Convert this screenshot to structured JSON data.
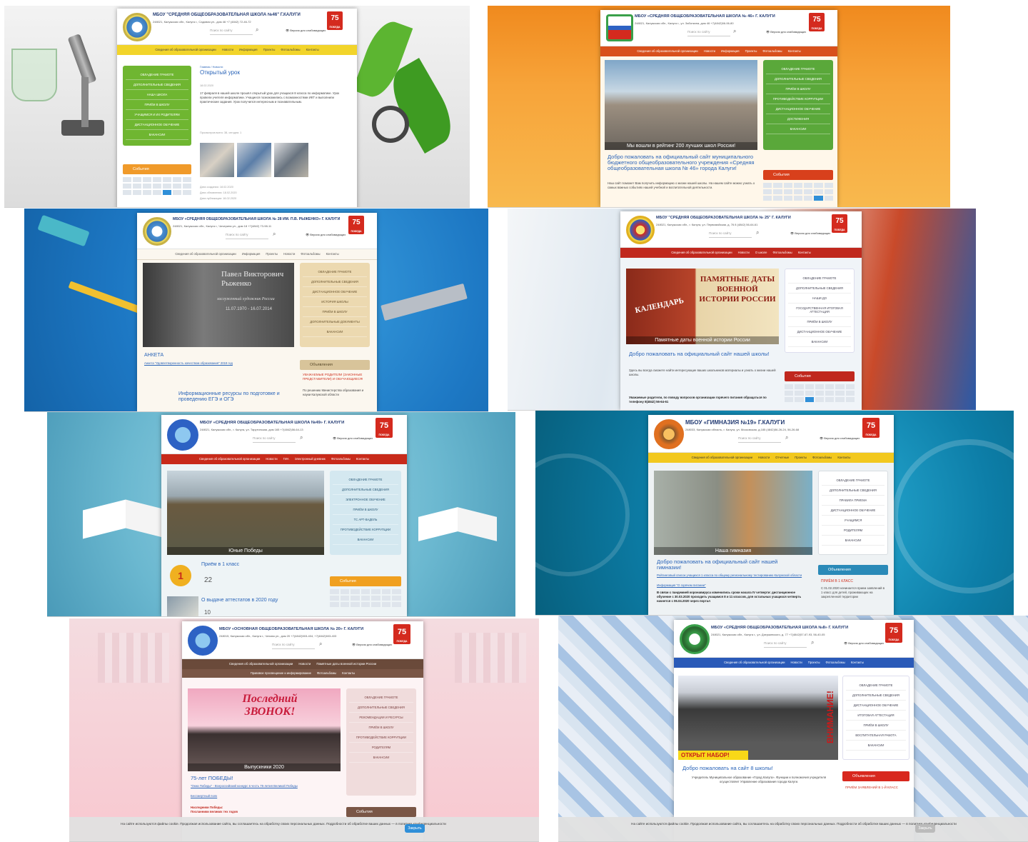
{
  "common": {
    "vision_label": "Версия для слабовидящих",
    "badge_number": "75",
    "badge_text": "ПОБЕДА"
  },
  "tile1": {
    "title": "МБОУ \"СРЕДНЯЯ ОБЩЕОБРАЗОВАТЕЛЬНАЯ ШКОЛА №46\" Г.КАЛУГИ",
    "address": "248021, Калужская обл., Калуга г., Садовая ул., дом 46   +7 (4842) 72-46-72",
    "search_placeholder": "Поиск по сайту",
    "nav": [
      "Сведения об образовательной организации",
      "Новости",
      "Информация",
      "Проекты",
      "Фотоальбомы",
      "Контакты"
    ],
    "side": [
      "Овладение грамоте",
      "Дополнительные сведения",
      "Наша школа",
      "Приём в школу",
      "Учащимся и их родителям",
      "Дистанционное обучение",
      "Вакансии"
    ],
    "breadcrumb": "Главная / Новости",
    "post_title": "Открытый урок",
    "post_date": "18.02.2020",
    "post_text": "17 февраля в нашей школе прошёл открытый урок для учащихся 8 класса по информатике. Урок провели учителя информатики. Учащиеся познакомились с возможностями ИКТ и выполнили практические задания. Урок получился интересным и познавательным.",
    "views": "Просмотров всего: 38, сегодня: 1",
    "events_label": "События",
    "dates": [
      "Дата создания: 18.02.2020",
      "Дата обновления: 18.02.2020",
      "Дата публикации: 18.02.2020"
    ]
  },
  "tile2": {
    "title": "МБОУ «СРЕДНЯЯ ОБЩЕОБРАЗОВАТЕЛЬНАЯ ШКОЛА № 46» Г. КАЛУГИ",
    "address": "248021, Калужская обл., Калуга г., ул. Заботкина, дом 46   +7(4842)56-06-80",
    "search_placeholder": "Поиск по сайту",
    "nav": [
      "Сведения об образовательной организации",
      "Новости",
      "Информация",
      "Проекты",
      "Фотоальбомы",
      "Контакты"
    ],
    "side": [
      "Овладение грамоте",
      "Дополнительные сведения",
      "Приём в школу",
      "Противодействие коррупции",
      "Дистанционное обучение",
      "Достижения",
      "Вакансии"
    ],
    "photo_caption": "Мы вошли в рейтинг 200 лучших школ России!",
    "welcome": "Добро пожаловать на официальный сайт муниципального бюджетного общеобразовательного учреждения «Средняя общеобразовательная школа № 46» города Калуги!",
    "text": "Наш сайт поможет Вам получить информацию о жизни нашей школы. На нашем сайте можно узнать о самых важных событиях нашей учебной и воспитательной деятельности.",
    "events_label": "События"
  },
  "tile3": {
    "title": "МБОУ «СРЕДНЯЯ ОБЩЕОБРАЗОВАТЕЛЬНАЯ ШКОЛА № 28 ИМ. П.В. РЫЖЕНКО» Г. КАЛУГИ",
    "address": "248021, Калужская обл., Калуга г., Чичерина ул., дом 18   +7(4842) 73-98-11",
    "search_placeholder": "Поиск по сайту",
    "nav": [
      "Сведения об образовательной организации",
      "Информация",
      "Проекты",
      "Новости",
      "Фотоальбомы",
      "Контакты"
    ],
    "side": [
      "Овладение грамоте",
      "Дополнительные сведения",
      "Дистанционное обучение",
      "История школы",
      "Приём в школу",
      "Дополнительные документы",
      "Вакансии"
    ],
    "photo_name": "Павел Викторович Рыженко",
    "photo_sub": "заслуженный художник России",
    "photo_years": "11.07.1970 - 16.07.2014",
    "anketa_title": "АНКЕТА",
    "anketa_link": "Анкета \"Удовлетворенность качеством образования\" 2019 год",
    "ads_label": "Объявления",
    "ads_title": "УВАЖАЕМЫЕ РОДИТЕЛИ (ЗАКОННЫЕ ПРЕДСТАВИТЕЛИ) И ОБУЧАЮЩИЕСЯ!",
    "ads_text": "По решению Министерства образования и науки Калужской области",
    "info_title": "Информационные ресурсы по подготовке и проведению ЕГЭ и ОГЭ"
  },
  "tile4": {
    "title": "МБОУ \"СРЕДНЯЯ ОБЩЕОБРАЗОВАТЕЛЬНАЯ ШКОЛА № 25\" Г. КАЛУГИ",
    "address": "248021, Калужская обл., г. Калуга, ул. Первомайская, д. 76   8 (4842) 56-64-61",
    "search_placeholder": "Поиск по сайту",
    "nav": [
      "Сведения об образовательной организации",
      "Новости",
      "О школе",
      "Фотоальбомы",
      "Контакты"
    ],
    "side": [
      "Овладение грамоте",
      "Дополнительные сведения",
      "Наши ДО",
      "Государственная итоговая аттестация",
      "Приём в школу",
      "Дистанционное обучение",
      "Вакансии"
    ],
    "banner_left": "КАЛЕНДАРЬ",
    "banner_right": "ПАМЯТНЫЕ ДАТЫ ВОЕННОЙ ИСТОРИИ РОССИИ",
    "photo_caption": "Памятные даты военной истории России",
    "welcome": "Добро пожаловать на официальный сайт нашей школы!",
    "text": "Здесь вы всегда сможете найти интересующие ваших школьников материалы и узнать о жизни нашей школы.",
    "bold": "Уважаемые родители, по поводу вопросов организации горячего питания обращаться по телефону 8(4842) 56-64-61",
    "events_label": "События"
  },
  "tile5": {
    "title": "МБОУ «СРЕДНЯЯ ОБЩЕОБРАЗОВАТЕЛЬНАЯ ШКОЛА №49» Г. КАЛУГИ",
    "address": "248021, Калужская обл., г. Калуга, ул. Тарутинская, дом 165   +7(4842)56-64-13",
    "search_placeholder": "Поиск по сайту",
    "nav": [
      "Сведения об образовательной организации",
      "Новости",
      "ГИА",
      "Электронный дневник",
      "Фотоальбомы",
      "Контакты"
    ],
    "side": [
      "Овладение грамоте",
      "Дополнительные сведения",
      "Электронное обучение",
      "Приём в школу",
      "ТС АРТ-ВАДЕЛЬ",
      "Противодействие коррупции",
      "Вакансии"
    ],
    "photo_caption": "Юные Победы",
    "news1": "Приём в 1 класс",
    "news1_count": "22",
    "news2": "О выдаче аттестатов в 2020 году",
    "news2_count": "10",
    "events_label": "События"
  },
  "tile6": {
    "title": "МБОУ «ГИМНАЗИЯ №19» Г.КАЛУГИ",
    "address": "248033, Калужская область, г. Калуга, ул. Московская, д.185   (4842)56-26-24, 56-26-68",
    "search_placeholder": "Поиск по сайту",
    "nav": [
      "Сведения об образовательной организации",
      "Новости",
      "Отчетные",
      "Проекты",
      "Фотоальбомы",
      "Контакты"
    ],
    "side": [
      "Овладение грамоте",
      "Дополнительные сведения",
      "Правила приема",
      "Дистанционное обучение",
      "Учащимся",
      "Родителям",
      "Вакансии"
    ],
    "photo_caption": "Наша гимназия",
    "welcome": "Добро пожаловать на официальный сайт нашей гимназии!",
    "link1": "Рейтинговый список учащихся 1 класса по общему региональному тестированию Калужской области",
    "link2": "Информация \"О горячем питании\"",
    "bold": "В связи с пандемией коронавируса изменились сроки начала IV четверти: дистанционное обучение с 30.03.2020 проходить учащимся 8 и 11 классов, для остальных учащихся четверть начнется с 06.04.2020 через портал",
    "ads_label": "Объявления",
    "ads_title": "ПРИЁМ В 1 КЛАСС",
    "ads_text": "С 01.02.2020 начинается прием заявлений в 1 класс для детей, проживающих на закрепленной территории"
  },
  "tile7": {
    "title": "МБОУ «ОСНОВНАЯ ОБЩЕОБРАЗОВАТЕЛЬНАЯ ШКОЛА № 20» Г. КАЛУГИ",
    "address": "248015, Калужская обл., Калуга г., Чехова ул., дом 20   +7(4842)503-404, +7(4842)503-403",
    "search_placeholder": "Поиск по сайту",
    "nav": [
      "Сведения об образовательной организации",
      "Новости",
      "Памятные даты военной истории России"
    ],
    "nav2": [
      "Правовое просвещение и информирование",
      "Фотоальбомы",
      "Контакты"
    ],
    "side": [
      "Овладение грамоте",
      "Дополнительные сведения",
      "Рекомендации и ресурсы",
      "Приём в школу",
      "Противодействие коррупции",
      "Родителям",
      "Вакансии"
    ],
    "banner_title": "Последний ЗВОНОК!",
    "photo_caption": "Выпускники 2020",
    "pobeda_title": "75-лет ПОБЕДЫ!",
    "pobeda_link": "\"Окна Победы\" - Всероссийский конкурс в честь 75-летия Великой Победы",
    "pobeda_link2": "Бессмертный полк",
    "heir1": "Наследники Победы:",
    "heir2": "Посланники великих тех годов",
    "events_label": "События",
    "cookie": "На сайте используются файлы cookie. Продолжая использование сайта, вы соглашаетесь на обработку своих персональных данных. Подробности об обработке ваших данных — в политике конфиденциальности",
    "cookie_btn": "Закрыть"
  },
  "tile8": {
    "title": "МБОУ «СРЕДНЯЯ ОБЩЕОБРАЗОВАТЕЛЬНАЯ ШКОЛА №8» Г. КАЛУГИ",
    "address": "248021, Калужская обл., Калуга г., ул. Дзержинского, д. 77   +7(4842)57-67-93, 56-40-05",
    "search_placeholder": "Поиск по сайту",
    "nav": [
      "Сведения об образовательной организации",
      "Новости",
      "Проекты",
      "Фотоальбомы",
      "Контакты"
    ],
    "side": [
      "Овладение грамоте",
      "Дополнительные сведения",
      "Дистанционное обучение",
      "Итоговая аттестация",
      "Приём в школу",
      "Воспитательная работа",
      "Вакансии"
    ],
    "banner_bottom": "ОТКРЫТ НАБОР!",
    "banner_side": "ВНИМАНИЕ!",
    "welcome": "Добро пожаловать на сайт 8 школы!",
    "text": "Учредитель Муниципальное образование «Город Калуга». Функции и полномочия учредителя осуществляет Управление образования города Калуги.",
    "ads_label": "Объявления",
    "ads_title": "ПРИЁМ ЗАЯВЛЕНИЙ В 1-Й КЛАСС",
    "cookie": "На сайте используются файлы cookie. Продолжая использование сайта, вы соглашаетесь на обработку своих персональных данных. Подробности об обработке ваших данных — в политике конфиденциальности",
    "cookie_btn": "Закрыть"
  }
}
